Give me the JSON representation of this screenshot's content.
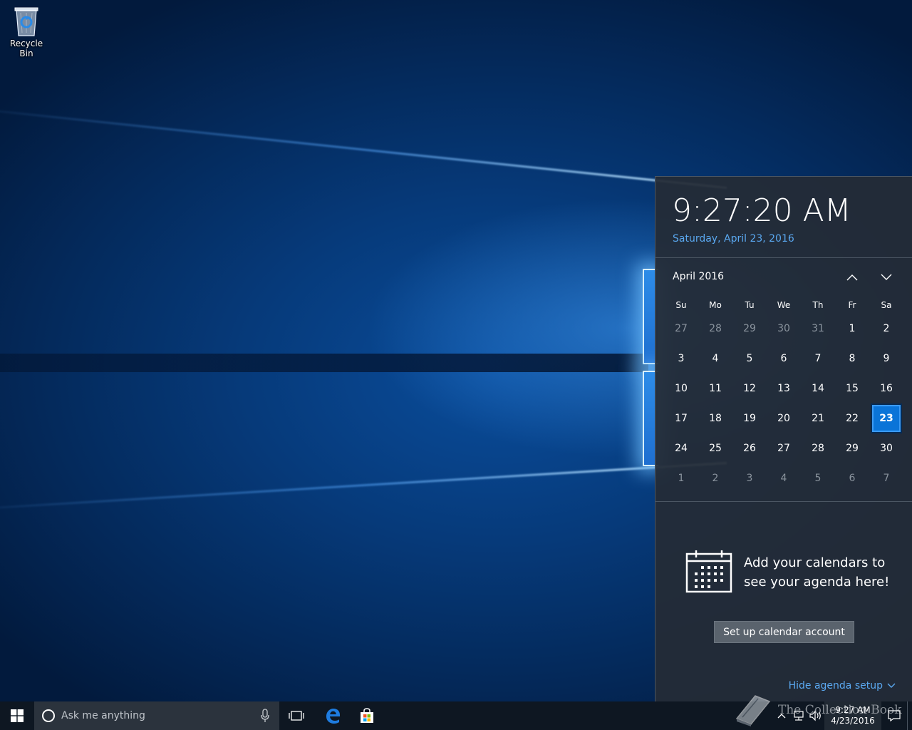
{
  "desktop": {
    "icons": [
      {
        "label": "Recycle Bin",
        "icon": "recycle-bin-icon"
      }
    ]
  },
  "flyout": {
    "time": "9:27:20 AM",
    "date": "Saturday, April 23, 2016",
    "calendar": {
      "month_label": "April 2016",
      "weekdays": [
        "Su",
        "Mo",
        "Tu",
        "We",
        "Th",
        "Fr",
        "Sa"
      ],
      "weeks": [
        [
          {
            "d": "27",
            "other": true
          },
          {
            "d": "28",
            "other": true
          },
          {
            "d": "29",
            "other": true
          },
          {
            "d": "30",
            "other": true
          },
          {
            "d": "31",
            "other": true
          },
          {
            "d": "1"
          },
          {
            "d": "2"
          }
        ],
        [
          {
            "d": "3"
          },
          {
            "d": "4"
          },
          {
            "d": "5"
          },
          {
            "d": "6"
          },
          {
            "d": "7"
          },
          {
            "d": "8"
          },
          {
            "d": "9"
          }
        ],
        [
          {
            "d": "10"
          },
          {
            "d": "11"
          },
          {
            "d": "12"
          },
          {
            "d": "13"
          },
          {
            "d": "14"
          },
          {
            "d": "15"
          },
          {
            "d": "16"
          }
        ],
        [
          {
            "d": "17"
          },
          {
            "d": "18"
          },
          {
            "d": "19"
          },
          {
            "d": "20"
          },
          {
            "d": "21"
          },
          {
            "d": "22"
          },
          {
            "d": "23",
            "today": true
          }
        ],
        [
          {
            "d": "24"
          },
          {
            "d": "25"
          },
          {
            "d": "26"
          },
          {
            "d": "27"
          },
          {
            "d": "28"
          },
          {
            "d": "29"
          },
          {
            "d": "30"
          }
        ],
        [
          {
            "d": "1",
            "other": true
          },
          {
            "d": "2",
            "other": true
          },
          {
            "d": "3",
            "other": true
          },
          {
            "d": "4",
            "other": true
          },
          {
            "d": "5",
            "other": true
          },
          {
            "d": "6",
            "other": true
          },
          {
            "d": "7",
            "other": true
          }
        ]
      ]
    },
    "agenda": {
      "message": "Add your calendars to see your agenda here!",
      "setup_button": "Set up calendar account",
      "hide_link": "Hide agenda setup"
    }
  },
  "taskbar": {
    "search_placeholder": "Ask me anything",
    "pinned": [
      "task-view-icon",
      "edge-icon",
      "store-icon"
    ],
    "clock": {
      "time": "9:27 AM",
      "date": "4/23/2016"
    }
  },
  "watermark": {
    "text": "The Collection Book"
  },
  "colors": {
    "accent": "#0a74d8",
    "link": "#5aa8f0",
    "flyout_bg": "#242c36",
    "taskbar_bg": "#0e1722"
  }
}
